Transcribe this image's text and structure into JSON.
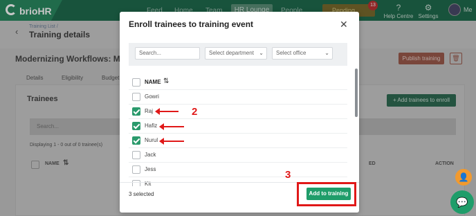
{
  "topbar": {
    "brand": "brioHR",
    "nav": [
      "Feed",
      "Home",
      "Team",
      "HR Lounge",
      "People"
    ],
    "active_nav": "HR Lounge",
    "pending_label": "Pending Actions",
    "pending_count": "13",
    "help_label": "Help Centre",
    "settings_label": "Settings",
    "user_label": "Me"
  },
  "page": {
    "breadcrumb": "Training List /",
    "title": "Training details",
    "training_name": "Modernizing Workflows: Maste",
    "publish_label": "Publish training",
    "tabs": [
      "Details",
      "Eligibility",
      "Budget"
    ],
    "trainees_title": "Trainees",
    "add_trainees_label": "+ Add trainees to enroll",
    "search_placeholder": "Search...",
    "displaying_text": "Displaying 1 - 0 out of 0 trainee(s)",
    "table_cols": [
      "NAME",
      "ED",
      "ACTION"
    ]
  },
  "modal": {
    "title": "Enroll trainees to training event",
    "search_placeholder": "Search...",
    "department_placeholder": "Select department",
    "office_placeholder": "Select office",
    "list_header": "NAME",
    "trainees": [
      {
        "name": "Gowri",
        "checked": false
      },
      {
        "name": "Raj",
        "checked": true
      },
      {
        "name": "Hafiz",
        "checked": true
      },
      {
        "name": "Nurul",
        "checked": true
      },
      {
        "name": "Jack",
        "checked": false
      },
      {
        "name": "Jess",
        "checked": false
      },
      {
        "name": "Kit",
        "checked": false
      }
    ],
    "selected_text": "3 selected",
    "add_button": "Add to training"
  },
  "annotations": {
    "step_2": "2",
    "step_3": "3",
    "color": "#e01818"
  },
  "colors": {
    "brand_green": "#1f9d6a",
    "checkbox_green": "#2a9a6c"
  }
}
